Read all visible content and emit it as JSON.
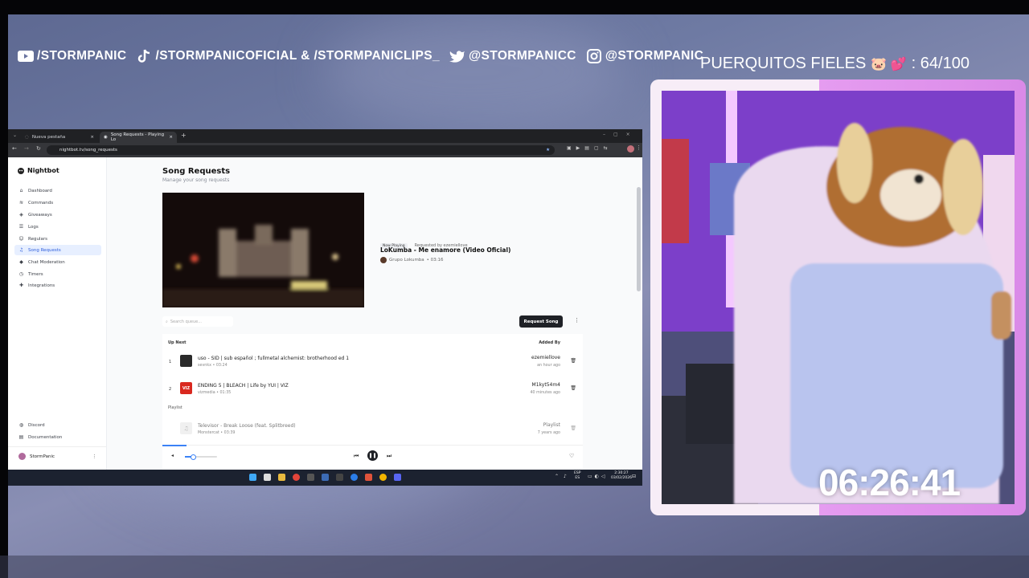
{
  "overlay": {
    "socials": [
      {
        "icon": "youtube-icon",
        "label": "/STORMPANIC"
      },
      {
        "icon": "tiktok-icon",
        "label": "/STORMPANICOFICIAL & /STORMPANICLIPS_"
      },
      {
        "icon": "twitter-icon",
        "label": "@STORMPANICC"
      },
      {
        "icon": "instagram-icon",
        "label": "@STORMPANIC"
      }
    ],
    "goal_label": "PUERQUITOS FIELES",
    "goal_emoji": "🐷 💕",
    "goal_count": ": 64/100",
    "timer": "06:26:41"
  },
  "browser": {
    "tabs": [
      {
        "label": "Nueva pestaña",
        "active": false
      },
      {
        "label": "Song Requests - Playing Lo",
        "active": true
      }
    ],
    "url": "nightbot.tv/song_requests"
  },
  "sidebar": {
    "brand": "Nightbot",
    "items": [
      {
        "label": "Dashboard",
        "icon": "home-icon"
      },
      {
        "label": "Commands",
        "icon": "commands-icon"
      },
      {
        "label": "Giveaways",
        "icon": "giveaway-icon"
      },
      {
        "label": "Logs",
        "icon": "logs-icon"
      },
      {
        "label": "Regulars",
        "icon": "users-icon"
      },
      {
        "label": "Song Requests",
        "icon": "headphones-icon",
        "selected": true
      },
      {
        "label": "Chat Moderation",
        "icon": "shield-icon"
      },
      {
        "label": "Timers",
        "icon": "clock-icon"
      },
      {
        "label": "Integrations",
        "icon": "puzzle-icon"
      }
    ],
    "bottom": [
      {
        "label": "Discord",
        "icon": "discord-icon"
      },
      {
        "label": "Documentation",
        "icon": "book-icon"
      }
    ],
    "user": "StormPanic"
  },
  "main": {
    "title": "Song Requests",
    "subtitle": "Manage your song requests",
    "now_playing_badge": "Now Playing",
    "requested_by": "Requested by ezemiellove",
    "song_title": "LoKumba - Me enamore (Video Oficial)",
    "song_artist": "Grupo Lokumba",
    "song_duration": "• 03:16",
    "search_placeholder": "Search queue...",
    "request_button": "Request Song",
    "up_next_header": "Up Next",
    "added_by_header": "Added By",
    "queue": [
      {
        "num": "1",
        "title": "uso - SID | sub español ; fullmetal alchemist: brotherhood ed 1",
        "meta": "sevnkx • 03:24",
        "user": "ezemiellove",
        "when": "an hour ago"
      },
      {
        "num": "2",
        "title": "ENDING 5 | BLEACH | Life by YUI | VIZ",
        "meta": "vizmedia • 01:35",
        "user": "M1kyt54m4",
        "when": "40 minutes ago"
      }
    ],
    "playlist_header": "Playlist",
    "playlist": [
      {
        "title": "Televisor - Break Loose (feat. Splitbreed)",
        "meta": "Monstercat • 03:39",
        "user": "Playlist",
        "when": "7 years ago"
      }
    ]
  },
  "taskbar": {
    "lang": "ESP",
    "lang2": "ES",
    "time": "2:30:27",
    "date": "03/02/2026"
  }
}
